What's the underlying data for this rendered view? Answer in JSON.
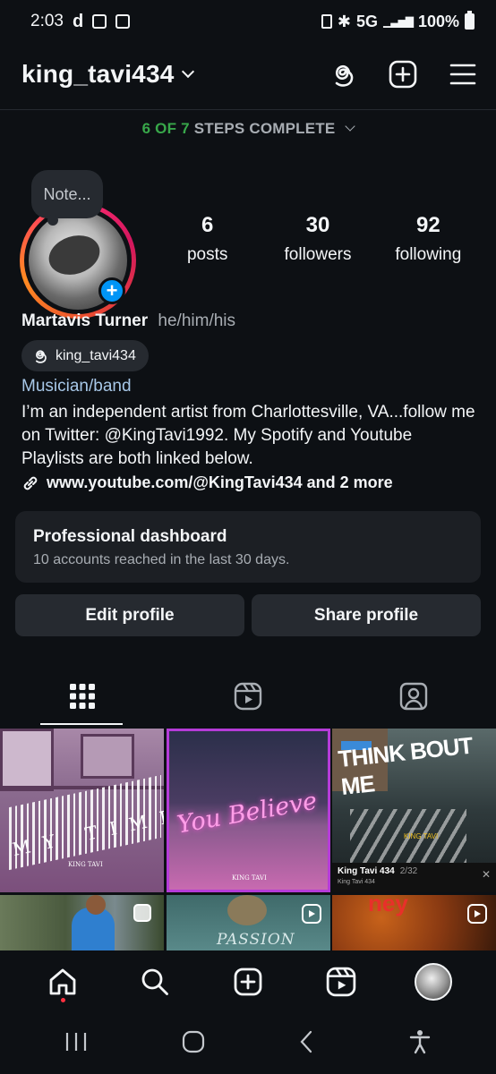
{
  "status_bar": {
    "time": "2:03",
    "network": "5G",
    "battery_percent": "100%"
  },
  "header": {
    "username": "king_tavi434",
    "icons": [
      "threads-icon",
      "new-post-icon",
      "menu-icon"
    ]
  },
  "steps": {
    "done": "6 OF 7",
    "label": "STEPS COMPLETE"
  },
  "profile": {
    "note": "Note...",
    "stats": [
      {
        "value": "6",
        "label": "posts"
      },
      {
        "value": "30",
        "label": "followers"
      },
      {
        "value": "92",
        "label": "following"
      }
    ],
    "name": "Martavis Turner",
    "pronouns": "he/him/his",
    "threads_handle": "king_tavi434",
    "category": "Musician/band",
    "bio": "I’m an independent artist from Charlottesville, VA...follow me on Twitter: @KingTavi1992. My Spotify and Youtube Playlists are both linked below.",
    "link": "www.youtube.com/@KingTavi434 and 2 more"
  },
  "dashboard": {
    "title": "Professional dashboard",
    "subtitle": "10 accounts reached in the last 30 days."
  },
  "buttons": {
    "edit": "Edit profile",
    "share": "Share profile"
  },
  "grid": {
    "tile1_text": "M Y   T I M E",
    "tile1_small": "KING TAVI",
    "tile2_text": "You Believe",
    "tile2_small": "KING TAVI",
    "tile3_text": "THINK BOUT ME",
    "tile3_small": "KING TAVI",
    "tile3_caption": "King Tavi 434",
    "tile3_time": "2/32",
    "tile3_channel": "King Tavi 434",
    "tile5_text": "PASSION",
    "tile6_text": "ney"
  },
  "colors": {
    "background": "#0d1014",
    "accent_blue": "#0095f6",
    "steps_green": "#38a74a",
    "category_blue": "#a7c7e7"
  }
}
